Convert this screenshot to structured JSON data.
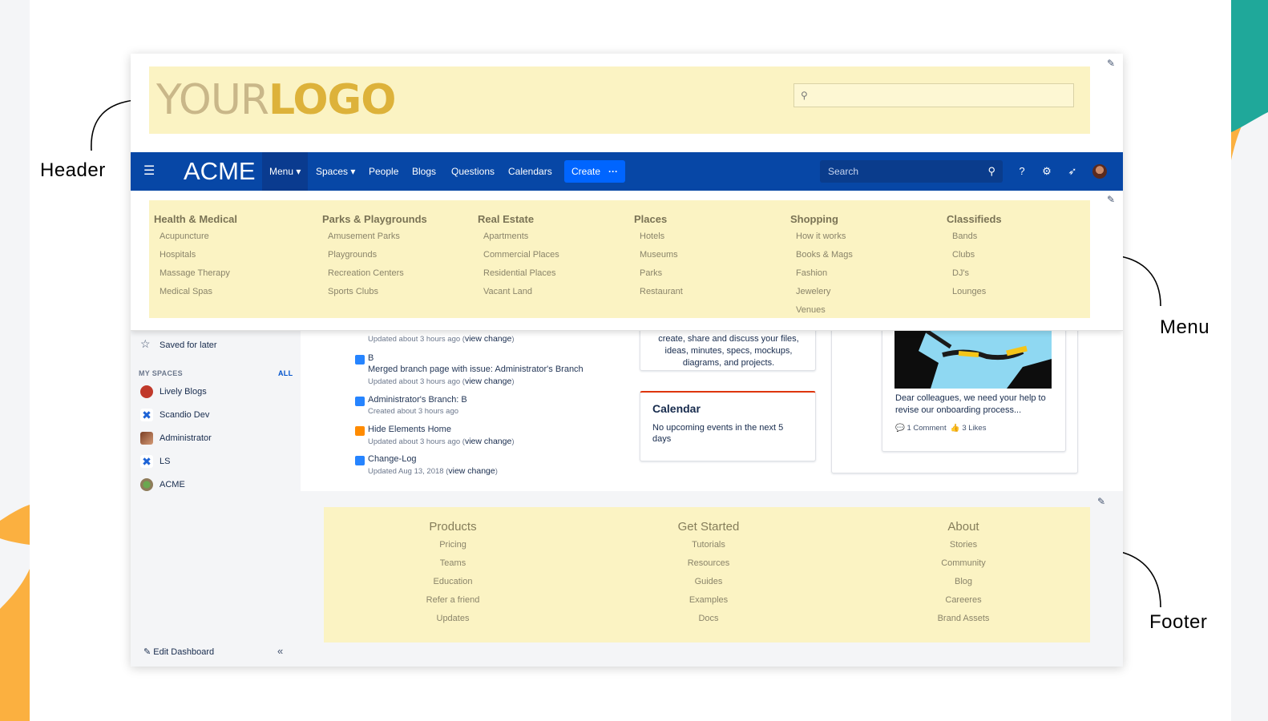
{
  "callouts": {
    "header": "Header",
    "menu": "Menu",
    "footer": "Footer"
  },
  "header": {
    "logo_part1": "YOUR",
    "logo_part2": "LOGO",
    "search_placeholder": ""
  },
  "nav": {
    "brand": "ACME",
    "items": [
      "Menu",
      "Spaces",
      "People",
      "Blogs",
      "Questions",
      "Calendars"
    ],
    "create_label": "Create",
    "search_placeholder": "Search"
  },
  "menu": {
    "columns": [
      {
        "heading": "Health & Medical",
        "links": [
          "Acupuncture",
          "Hospitals",
          "Massage Therapy",
          "Medical Spas"
        ]
      },
      {
        "heading": "Parks & Playgrounds",
        "links": [
          "Amusement Parks",
          "Playgrounds",
          "Recreation Centers",
          "Sports Clubs"
        ]
      },
      {
        "heading": "Real Estate",
        "links": [
          "Apartments",
          "Commercial Places",
          "Residential Places",
          "Vacant Land"
        ]
      },
      {
        "heading": "Places",
        "links": [
          "Hotels",
          "Museums",
          "Parks",
          "Restaurant"
        ]
      },
      {
        "heading": "Shopping",
        "links": [
          "How it works",
          "Books & Mags",
          "Fashion",
          "Jewelery",
          "Venues"
        ]
      },
      {
        "heading": "Classifieds",
        "links": [
          "Bands",
          "Clubs",
          "DJ's",
          "Lounges"
        ]
      }
    ]
  },
  "sidebar": {
    "saved": "Saved for later",
    "my_spaces_label": "MY SPACES",
    "all_label": "ALL",
    "spaces": [
      "Lively Blogs",
      "Scandio Dev",
      "Administrator",
      "LS",
      "ACME"
    ],
    "edit_dashboard": "Edit Dashboard",
    "collapse": "«"
  },
  "activity": [
    {
      "title": "B",
      "subtitle": "Merged branch page with issue: Administrator's Branch",
      "meta": "Updated about 3 hours ago (",
      "link": "view change",
      "tail": ")"
    },
    {
      "title": "Administrator's Branch: B",
      "meta": "Created about 3 hours ago",
      "link": "",
      "tail": ""
    },
    {
      "title": "Hide Elements Home",
      "meta": "Updated about 3 hours ago (",
      "link": "view change",
      "tail": ")"
    },
    {
      "title": "Change-Log",
      "meta": "Updated Aug 13, 2018 (",
      "link": "view change",
      "tail": ")"
    }
  ],
  "activity_top_meta": {
    "meta": "Updated about 3 hours ago (",
    "link": "view change",
    "tail": ")"
  },
  "intro_card": {
    "text": "create, share and discuss your files, ideas, minutes, specs, mockups, diagrams, and projects."
  },
  "calendar_card": {
    "title": "Calendar",
    "text": "No upcoming events in the next 5 days"
  },
  "post_card": {
    "text": "Dear colleagues, we need your help to revise our onboarding process...",
    "comments": "1 Comment",
    "likes": "3 Likes"
  },
  "footer": {
    "columns": [
      {
        "heading": "Products",
        "links": [
          "Pricing",
          "Teams",
          "Education",
          "Refer a friend",
          "Updates"
        ]
      },
      {
        "heading": "Get Started",
        "links": [
          "Tutorials",
          "Resources",
          "Guides",
          "Examples",
          "Docs"
        ]
      },
      {
        "heading": "About",
        "links": [
          "Stories",
          "Community",
          "Blog",
          "Careeres",
          "Brand Assets"
        ]
      }
    ]
  },
  "colors": {
    "nav": "#0747a6",
    "highlight": "#fbf3c3",
    "create": "#0065ff",
    "accent_orange": "#fbb040",
    "accent_teal": "#1fa89a"
  }
}
